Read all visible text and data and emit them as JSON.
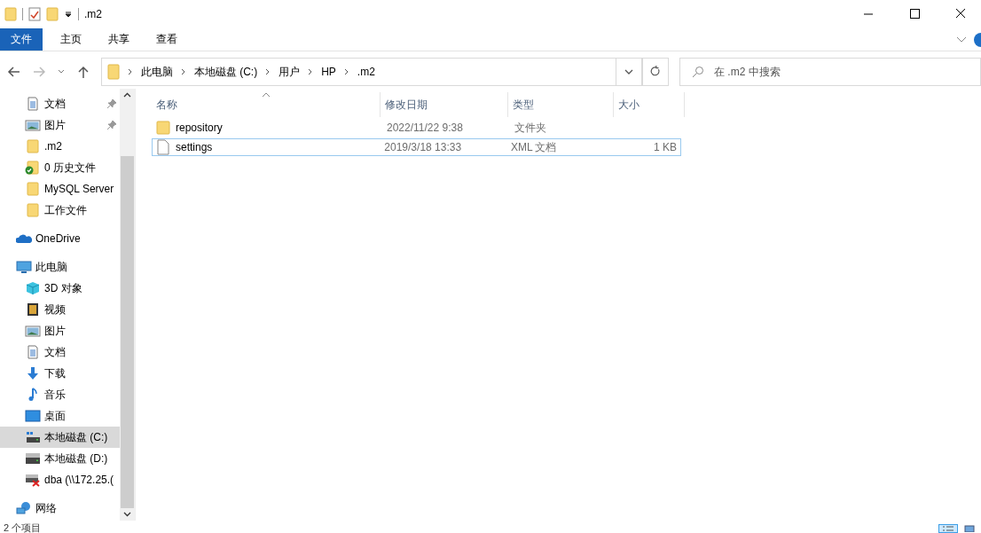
{
  "window": {
    "title": ".m2"
  },
  "ribbon_tabs": [
    {
      "label": "文件",
      "kind": "file",
      "selected": false
    },
    {
      "label": "主页",
      "kind": "tab",
      "selected": false
    },
    {
      "label": "共享",
      "kind": "tab",
      "selected": false
    },
    {
      "label": "查看",
      "kind": "tab",
      "selected": false
    }
  ],
  "address": {
    "crumbs": [
      "此电脑",
      "本地磁盘 (C:)",
      "用户",
      "HP",
      ".m2"
    ]
  },
  "search": {
    "placeholder": "在 .m2 中搜索"
  },
  "nav": [
    {
      "kind": "quick",
      "children": [
        {
          "label": "文档",
          "kind": "doc",
          "pinned": true,
          "selected": false
        },
        {
          "label": "图片",
          "kind": "pictures",
          "pinned": true,
          "selected": false
        },
        {
          "label": ".m2",
          "kind": "folder",
          "pinned": false,
          "selected": false
        },
        {
          "label": "0 历史文件",
          "kind": "synced",
          "pinned": false,
          "selected": false
        },
        {
          "label": "MySQL Server",
          "kind": "folder",
          "pinned": false,
          "selected": false
        },
        {
          "label": "工作文件",
          "kind": "folder",
          "pinned": false,
          "selected": false
        }
      ]
    },
    {
      "kind": "cloud",
      "label": "OneDrive",
      "selected": false
    },
    {
      "kind": "pc",
      "label": "此电脑",
      "selected": false,
      "children": [
        {
          "label": "3D 对象",
          "kind": "cube",
          "pinned": false,
          "selected": false
        },
        {
          "label": "视频",
          "kind": "video",
          "pinned": false,
          "selected": false
        },
        {
          "label": "图片",
          "kind": "pictures",
          "pinned": false,
          "selected": false
        },
        {
          "label": "文档",
          "kind": "doc",
          "pinned": false,
          "selected": false
        },
        {
          "label": "下载",
          "kind": "download",
          "pinned": false,
          "selected": false
        },
        {
          "label": "音乐",
          "kind": "music",
          "pinned": false,
          "selected": false
        },
        {
          "label": "桌面",
          "kind": "desktop",
          "pinned": false,
          "selected": false
        },
        {
          "label": "本地磁盘 (C:)",
          "kind": "systemdrive",
          "pinned": false,
          "selected": true
        },
        {
          "label": "本地磁盘 (D:)",
          "kind": "drive",
          "pinned": false,
          "selected": false
        },
        {
          "label": "dba (\\\\172.25.(",
          "kind": "netdrive",
          "pinned": false,
          "selected": false
        }
      ]
    },
    {
      "kind": "network",
      "label": "网络",
      "selected": false
    }
  ],
  "columns": [
    {
      "label": "名称",
      "sorted": true
    },
    {
      "label": "修改日期",
      "sorted": false
    },
    {
      "label": "类型",
      "sorted": false
    },
    {
      "label": "大小",
      "sorted": false
    }
  ],
  "files": [
    {
      "name": "repository",
      "kind": "folder",
      "modified": "2022/11/22 9:38",
      "type": "文件夹",
      "focused": false
    },
    {
      "name": "settings",
      "kind": "file",
      "modified": "2019/3/18 13:33",
      "type": "XML 文档",
      "size": "1 KB",
      "focused": true
    }
  ],
  "status_bar": {
    "text": "2 个项目",
    "views": [
      {
        "kind": "details",
        "selected": true
      },
      {
        "kind": "large",
        "selected": false
      }
    ]
  }
}
